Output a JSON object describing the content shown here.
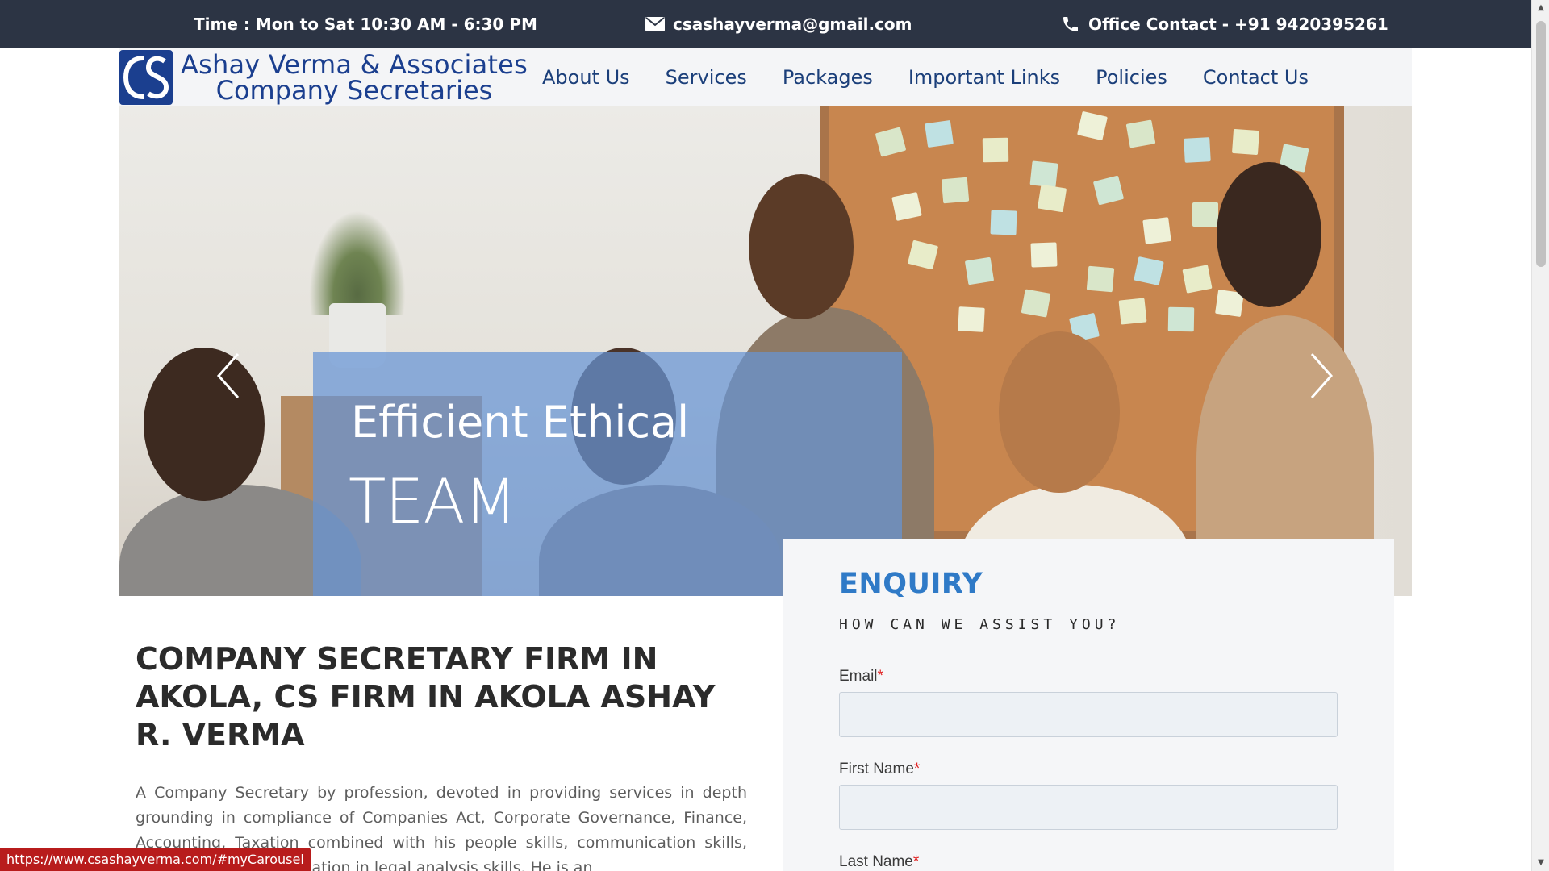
{
  "topbar": {
    "time_text": "Time : Mon to Sat 10:30 AM - 6:30 PM",
    "email_text": "csashayverma@gmail.com",
    "phone_text": "Office Contact - +91 9420395261",
    "email_icon": "envelope-icon",
    "phone_icon": "phone-icon",
    "background_color": "#2c3444"
  },
  "header": {
    "logo_icon": "cs-monogram-logo",
    "brand_line1": "Ashay Verma & Associates",
    "brand_line2": "Company Secretaries",
    "brand_color": "#1b3f8f",
    "nav": [
      {
        "label": "About Us"
      },
      {
        "label": "Services"
      },
      {
        "label": "Packages"
      },
      {
        "label": "Important Links"
      },
      {
        "label": "Policies"
      },
      {
        "label": "Contact Us"
      }
    ]
  },
  "hero": {
    "caption_line1": "Efficient Ethical",
    "caption_line2": "TEAM",
    "prev_icon": "chevron-left-icon",
    "next_icon": "chevron-right-icon",
    "caption_bg": "#6694d6"
  },
  "enquiry": {
    "title": "ENQUIRY",
    "subtitle": "HOW CAN WE ASSIST YOU?",
    "fields": [
      {
        "label": "Email",
        "required_mark": "*",
        "value": ""
      },
      {
        "label": "First Name",
        "required_mark": "*",
        "value": ""
      },
      {
        "label": "Last Name",
        "required_mark": "*",
        "value": ""
      }
    ],
    "accent_color": "#2f7ac7"
  },
  "content": {
    "title": "COMPANY SECRETARY FIRM IN AKOLA, CS FIRM IN AKOLA ASHAY R. VERMA",
    "body": "A Company Secretary by profession, devoted in providing services in depth grounding in compliance of Companies Act, Corporate Governance, Finance, Accounting, Taxation combined with his people skills, communication skills, presentation and inclination in legal analysis skills. He is an"
  },
  "status_bar": {
    "url": "https://www.csashayverma.com/#myCarousel"
  },
  "scrollbar": {
    "up_icon": "scroll-up-arrow-icon",
    "down_icon": "scroll-down-arrow-icon"
  }
}
